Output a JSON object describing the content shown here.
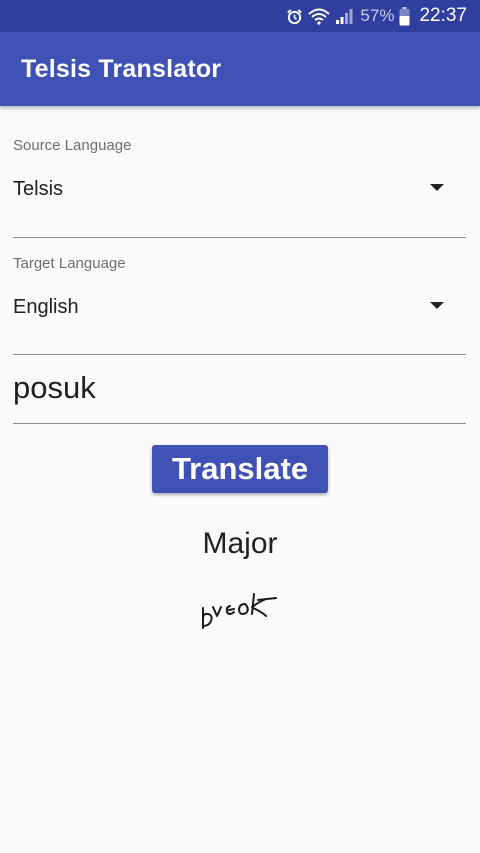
{
  "status_bar": {
    "battery_percent": "57%",
    "time": "22:37",
    "icons": [
      "alarm-icon",
      "wifi-icon",
      "signal-icon",
      "battery-icon"
    ]
  },
  "app_bar": {
    "title": "Telsis Translator"
  },
  "source_language": {
    "label": "Source Language",
    "value": "Telsis"
  },
  "target_language": {
    "label": "Target Language",
    "value": "English"
  },
  "input": {
    "value": "posuk"
  },
  "translate_button": {
    "label": "Translate"
  },
  "result": {
    "text": "Major",
    "script_glyph_icon": "telsis-script-glyph"
  },
  "colors": {
    "status_bar": "#303f9f",
    "app_bar": "#3f51b5",
    "button": "#3f51b5",
    "background": "#fafafa"
  }
}
